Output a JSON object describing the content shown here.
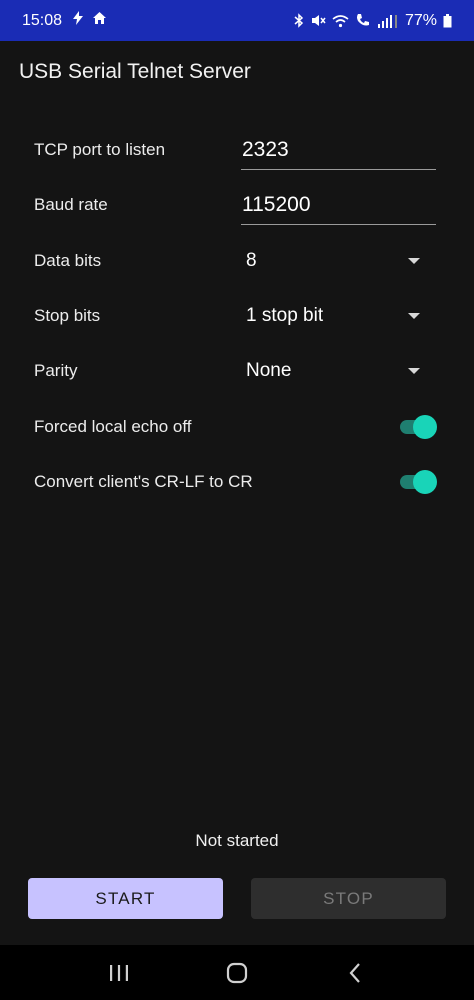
{
  "status_bar": {
    "time": "15:08",
    "battery": "77%",
    "icons": [
      "flash-icon",
      "home-icon",
      "bluetooth-icon",
      "mute-icon",
      "wifi-icon",
      "call-icon",
      "signal-icon",
      "battery-icon"
    ]
  },
  "app": {
    "title": "USB Serial Telnet Server"
  },
  "settings": {
    "tcp_port": {
      "label": "TCP port to listen",
      "value": "2323"
    },
    "baud_rate": {
      "label": "Baud rate",
      "value": "115200"
    },
    "data_bits": {
      "label": "Data bits",
      "value": "8"
    },
    "stop_bits": {
      "label": "Stop bits",
      "value": "1 stop bit"
    },
    "parity": {
      "label": "Parity",
      "value": "None"
    },
    "echo_off": {
      "label": "Forced local echo off",
      "enabled": true
    },
    "crlf": {
      "label": "Convert client's CR-LF to CR",
      "enabled": true
    }
  },
  "server": {
    "status": "Not started",
    "start_label": "START",
    "stop_label": "STOP"
  },
  "colors": {
    "status_bar": "#1a2cb5",
    "accent": "#19d4b8",
    "start_button": "#c7c2ff",
    "background": "#141414"
  }
}
